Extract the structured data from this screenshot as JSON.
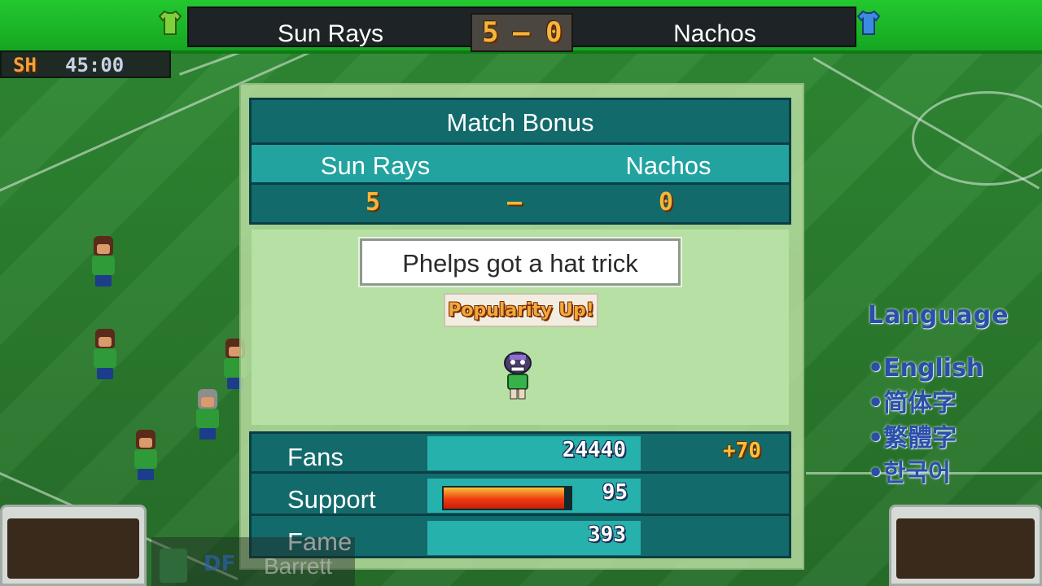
{
  "scoreboard": {
    "home_team": "Sun Rays",
    "away_team": "Nachos",
    "home_score": "5",
    "separator": "–",
    "away_score": "0",
    "home_jersey_color": "#7ed13a",
    "away_jersey_color": "#3b8be0"
  },
  "timer": {
    "half": "SH",
    "clock": "45:00"
  },
  "match_bonus": {
    "title": "Match Bonus",
    "home_team": "Sun Rays",
    "away_team": "Nachos",
    "home_score": "5",
    "separator": "–",
    "away_score": "0",
    "message": "Phelps got a hat trick",
    "badge": "Popularity Up!"
  },
  "stats": {
    "fans": {
      "label": "Fans",
      "value": "24440",
      "delta": "+70"
    },
    "support": {
      "label": "Support",
      "value": "95",
      "level": 0.95
    },
    "fame": {
      "label": "Fame",
      "value": "393"
    }
  },
  "language_menu": {
    "title": "Language",
    "options": [
      "•English",
      "•简体字",
      "•繁體字",
      "•한국어"
    ]
  },
  "bottom_player": {
    "position_badge": "DF",
    "name": "Barrett"
  },
  "colors": {
    "panel_teal": "#136a6b",
    "panel_light_teal": "#22a3a0",
    "field_green": "#2f8a33",
    "score_orange": "#f6b53a",
    "language_blue": "#2a4fa8"
  }
}
